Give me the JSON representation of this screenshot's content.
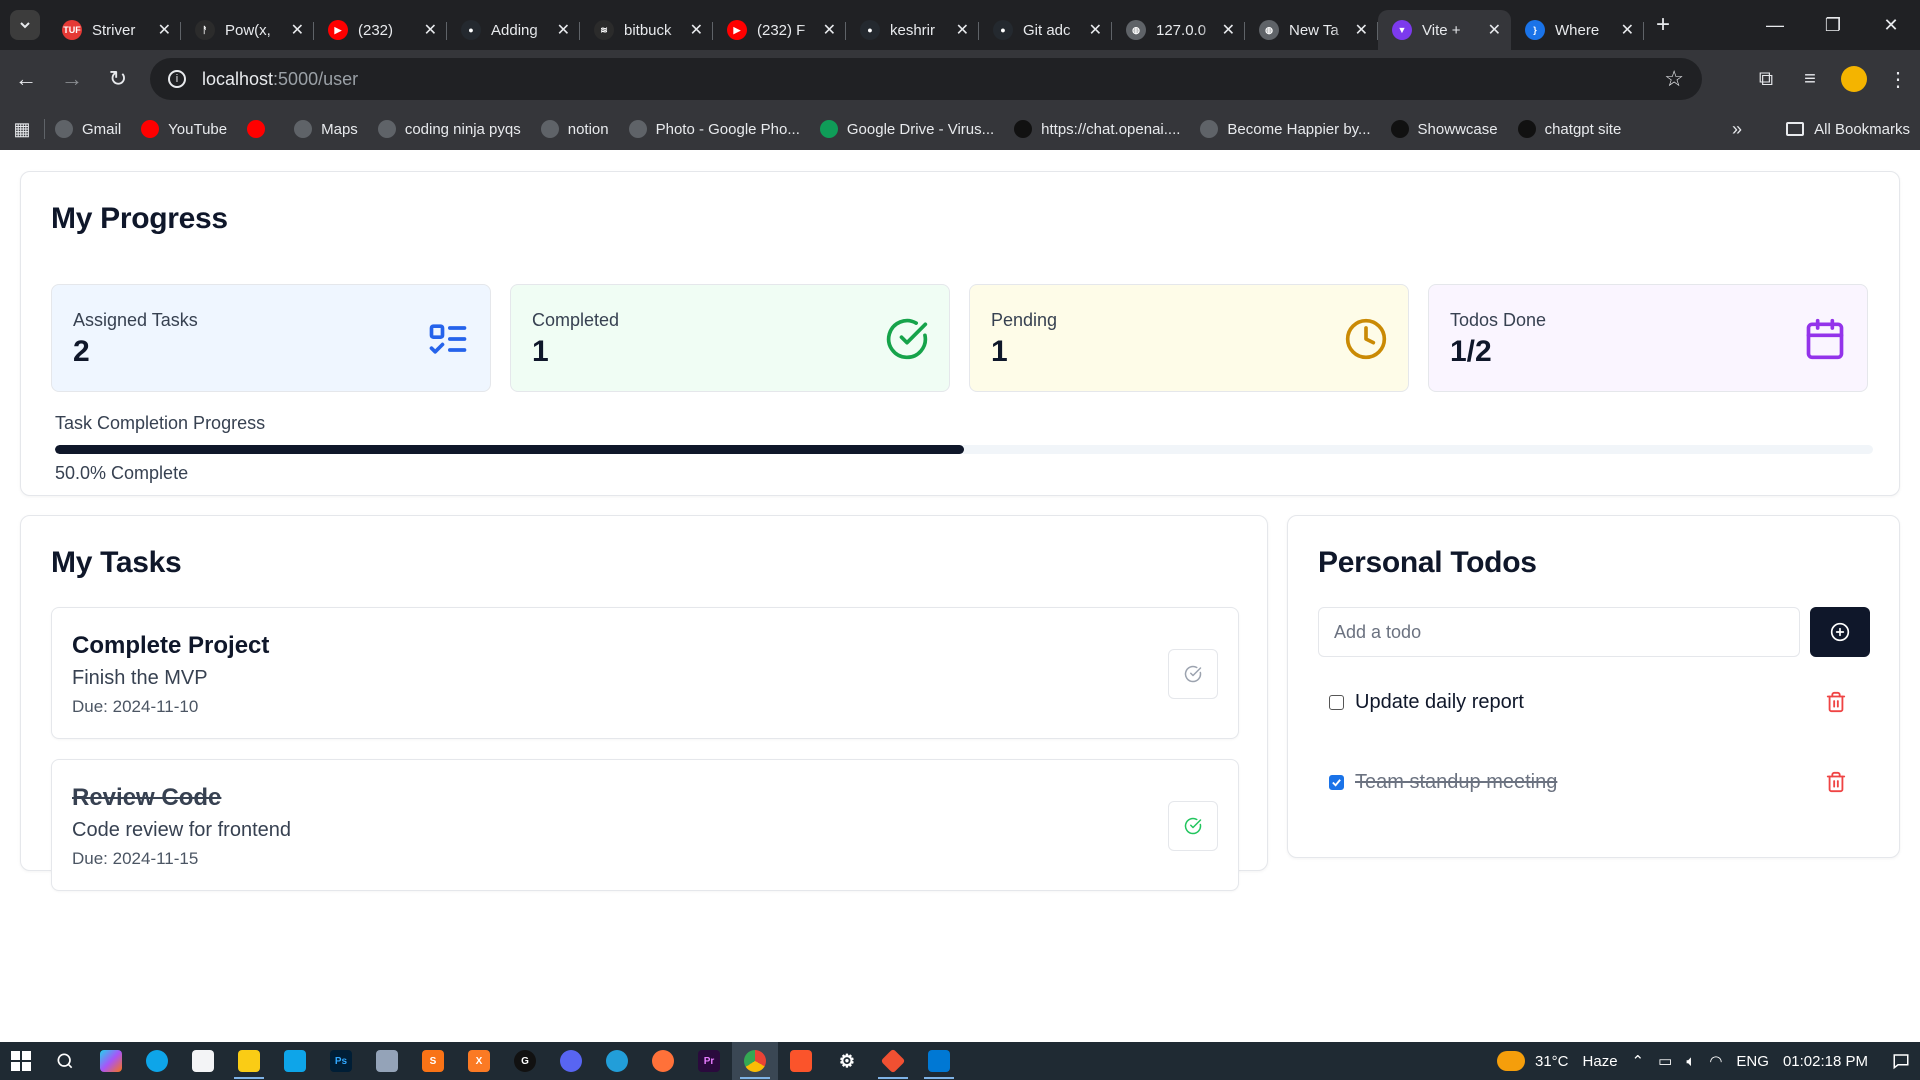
{
  "browser": {
    "tabs": [
      {
        "title": "Striver",
        "color": "#e53935",
        "badge": "TUF"
      },
      {
        "title": "Pow(x,",
        "color": "#2b2b2b",
        "badge": "ᚨ"
      },
      {
        "title": "(232)",
        "color": "#ff0000",
        "badge": "▶"
      },
      {
        "title": "Adding",
        "color": "#24292f",
        "badge": "●"
      },
      {
        "title": "bitbuck",
        "color": "#2b2b2b",
        "badge": "≋"
      },
      {
        "title": "(232) F",
        "color": "#ff0000",
        "badge": "▶"
      },
      {
        "title": "keshrir",
        "color": "#24292f",
        "badge": "●"
      },
      {
        "title": "Git adc",
        "color": "#24292f",
        "badge": "●"
      },
      {
        "title": "127.0.0",
        "color": "#5f6368",
        "badge": "◍"
      },
      {
        "title": "New Ta",
        "color": "#5f6368",
        "badge": "◍"
      },
      {
        "title": "Vite +",
        "color": "#7c3aed",
        "badge": "▼"
      },
      {
        "title": "Where",
        "color": "#1a73e8",
        "badge": "}"
      }
    ],
    "new_tab": "+",
    "url_host": "localhost",
    "url_path": ":5000/user",
    "bookmarks": [
      {
        "label": "Gmail",
        "color": "#5f6368"
      },
      {
        "label": "YouTube",
        "color": "#ff0000"
      },
      {
        "label": "",
        "color": "#ff0000"
      },
      {
        "label": "Maps",
        "color": "#5f6368"
      },
      {
        "label": "coding ninja pyqs",
        "color": "#5f6368"
      },
      {
        "label": "notion",
        "color": "#5f6368"
      },
      {
        "label": "Photo - Google Pho...",
        "color": "#5f6368"
      },
      {
        "label": "Google Drive - Virus...",
        "color": "#0f9d58"
      },
      {
        "label": "https://chat.openai....",
        "color": "#111111"
      },
      {
        "label": "Become Happier by...",
        "color": "#5f6368"
      },
      {
        "label": "Showwcase",
        "color": "#111111"
      },
      {
        "label": "chatgpt site",
        "color": "#111111"
      }
    ],
    "more_bookmarks": "»",
    "all_bookmarks": "All Bookmarks"
  },
  "progress": {
    "title": "My Progress",
    "stats": [
      {
        "label": "Assigned Tasks",
        "value": "2",
        "icon": "list-check-icon",
        "bg": "#eff6ff",
        "color": "#2563eb"
      },
      {
        "label": "Completed",
        "value": "1",
        "icon": "check-circle-icon",
        "bg": "#f0fdf4",
        "color": "#16a34a"
      },
      {
        "label": "Pending",
        "value": "1",
        "icon": "clock-icon",
        "bg": "#fefce8",
        "color": "#ca8a04"
      },
      {
        "label": "Todos Done",
        "value": "1/2",
        "icon": "calendar-icon",
        "bg": "#faf5ff",
        "color": "#9333ea"
      }
    ],
    "bar_label": "Task Completion Progress",
    "percent": 50.0,
    "percent_text": "50.0% Complete"
  },
  "tasks": {
    "title": "My Tasks",
    "items": [
      {
        "title": "Complete Project",
        "description": "Finish the MVP",
        "due": "Due: 2024-11-10",
        "completed": false
      },
      {
        "title": "Review Code",
        "description": "Code review for frontend",
        "due": "Due: 2024-11-15",
        "completed": true
      }
    ]
  },
  "todos": {
    "title": "Personal Todos",
    "placeholder": "Add a todo",
    "items": [
      {
        "text": "Update daily report",
        "done": false
      },
      {
        "text": "Team standup meeting",
        "done": true
      }
    ]
  },
  "taskbar": {
    "temperature": "31°C",
    "weather": "Haze",
    "language": "ENG",
    "time": "01:02:18 PM"
  },
  "colors": {
    "primary": "#0f172a",
    "danger": "#ef4444",
    "success": "#22c55e",
    "muted": "#9ca3af"
  }
}
